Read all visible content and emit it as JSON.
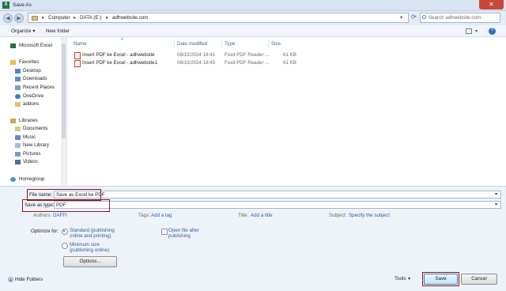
{
  "window": {
    "title": "Save As",
    "app_icon_letter": "X",
    "close_glyph": "✕"
  },
  "address": {
    "crumbs": [
      "Computer",
      "DATA (E:)",
      "adhwebsite.com"
    ],
    "separator": "▸"
  },
  "search": {
    "placeholder": "Search adhwebsite.com"
  },
  "toolbar": {
    "organize": "Organize ▾",
    "new_folder": "New folder"
  },
  "sidebar": {
    "items": [
      {
        "label": "Microsoft Excel"
      },
      {
        "label": "Favorites"
      },
      {
        "label": "Desktop"
      },
      {
        "label": "Downloads"
      },
      {
        "label": "Recent Places"
      },
      {
        "label": "OneDrive"
      },
      {
        "label": "addons"
      },
      {
        "label": "Libraries"
      },
      {
        "label": "Documents"
      },
      {
        "label": "Music"
      },
      {
        "label": "New Library"
      },
      {
        "label": "Pictures"
      },
      {
        "label": "Videos"
      },
      {
        "label": "Homegroup"
      }
    ]
  },
  "columns": [
    "Name",
    "Date modified",
    "Type",
    "Size"
  ],
  "files": [
    {
      "name": "Insert PDF ke Excel - adhwebsite",
      "date": "08/10/2024 18:41",
      "type": "Foxit PDF Reader ...",
      "size": "61 KB"
    },
    {
      "name": "Insert PDF ke Excel - adhwebsite1",
      "date": "08/10/2024 18:45",
      "type": "Foxit PDF Reader ...",
      "size": "61 KB"
    }
  ],
  "form": {
    "file_name_label": "File name:",
    "file_name_value": "Save as Excel ke PDF",
    "save_type_label": "Save as type:",
    "save_type_value": "PDF",
    "authors_label": "Authors:",
    "authors_value": "DAFFI",
    "tags_label": "Tags:",
    "tags_value": "Add a tag",
    "title_label": "Title:",
    "title_value": "Add a title",
    "subject_label": "Subject:",
    "subject_value": "Specify the subject",
    "optimize_label": "Optimize for:",
    "opt_standard_1": "Standard (publishing",
    "opt_standard_2": "online and printing)",
    "opt_minimum_1": "Minimum size",
    "opt_minimum_2": "(publishing online)",
    "open_after_1": "Open file after",
    "open_after_2": "publishing",
    "options_button": "Options..."
  },
  "footer": {
    "hide_folders": "Hide Folders",
    "tools": "Tools",
    "save": "Save",
    "cancel": "Cancel"
  },
  "colors": {
    "highlight": "#8b1a1a",
    "link": "#2e5fa8",
    "close": "#c7473a"
  }
}
